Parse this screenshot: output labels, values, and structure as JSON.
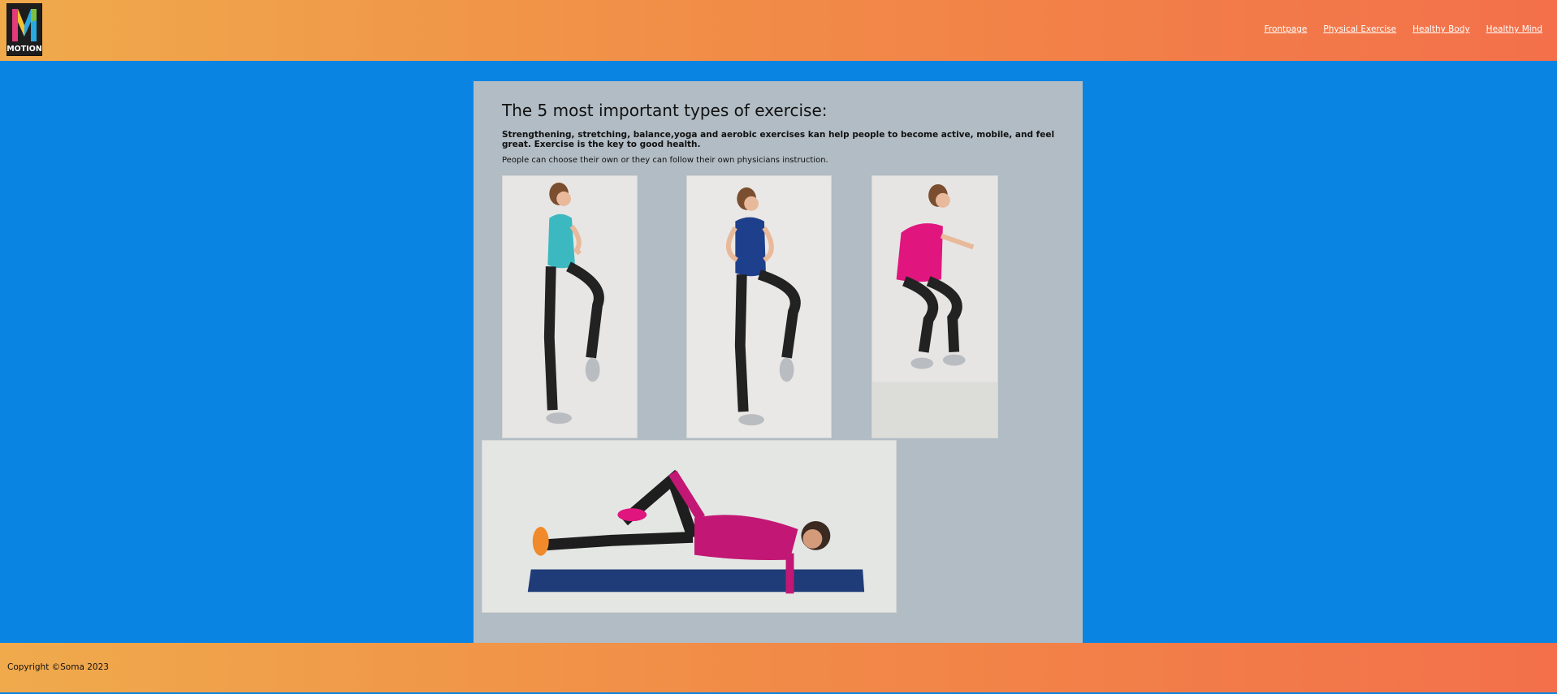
{
  "header": {
    "logo_text": "MOTION",
    "nav": [
      {
        "label": "Frontpage"
      },
      {
        "label": "Physical Exercise"
      },
      {
        "label": "Healthy Body"
      },
      {
        "label": "Healthy Mind"
      }
    ]
  },
  "main": {
    "title": "The 5 most important types of exercise:",
    "lead": "Strengthening, stretching, balance,yoga and aerobic exercises kan help people to become active, mobile, and feel great. Exercise is the key to good health.",
    "note": "People can choose their own or they can follow their own physicians instruction."
  },
  "footer": {
    "copyright": "Copyright ©Soma 2023"
  },
  "colors": {
    "background": "#0a84e2",
    "content_panel": "#b1bcc4",
    "header_gradient_start": "#f0aa4c",
    "header_gradient_end": "#f3704a"
  }
}
